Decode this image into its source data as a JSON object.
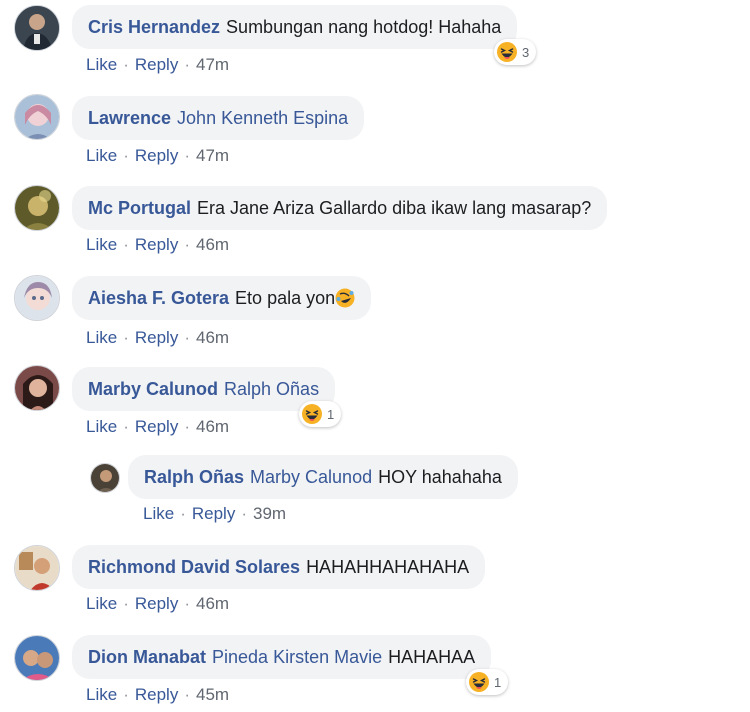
{
  "comments": [
    {
      "author": "Cris Hernandez",
      "mention": "",
      "text": "Sumbungan nang hotdog! Hahaha",
      "actions": {
        "like": "Like",
        "reply": "Reply",
        "time": "47m"
      },
      "reaction": {
        "count": "3",
        "icon": "laughing-emoji"
      }
    },
    {
      "author": "Lawrence",
      "mention": "John Kenneth Espina",
      "text": "",
      "actions": {
        "like": "Like",
        "reply": "Reply",
        "time": "47m"
      }
    },
    {
      "author": "Mc Portugal",
      "mention": "",
      "text": "Era Jane Ariza Gallardo diba ikaw lang masarap?",
      "actions": {
        "like": "Like",
        "reply": "Reply",
        "time": "46m"
      }
    },
    {
      "author": "Aiesha F. Gotera",
      "mention": "",
      "text": "Eto pala yon",
      "emoji": "rofl-emoji",
      "actions": {
        "like": "Like",
        "reply": "Reply",
        "time": "46m"
      }
    },
    {
      "author": "Marby Calunod",
      "mention": "Ralph Oñas",
      "text": "",
      "actions": {
        "like": "Like",
        "reply": "Reply",
        "time": "46m"
      },
      "reaction": {
        "count": "1",
        "icon": "laughing-emoji"
      },
      "reply": {
        "author": "Ralph Oñas",
        "mention": "Marby Calunod",
        "text": "HOY hahahaha",
        "actions": {
          "like": "Like",
          "reply": "Reply",
          "time": "39m"
        }
      }
    },
    {
      "author": "Richmond David Solares",
      "mention": "",
      "text": "HAHAHHAHAHAHA",
      "actions": {
        "like": "Like",
        "reply": "Reply",
        "time": "46m"
      }
    },
    {
      "author": "Dion Manabat",
      "mention": "Pineda Kirsten Mavie",
      "text": "HAHAHAA",
      "actions": {
        "like": "Like",
        "reply": "Reply",
        "time": "45m"
      },
      "reaction": {
        "count": "1",
        "icon": "laughing-emoji"
      }
    }
  ],
  "colors": {
    "link": "#385898",
    "bubble": "#f2f3f5",
    "meta": "#616770"
  }
}
